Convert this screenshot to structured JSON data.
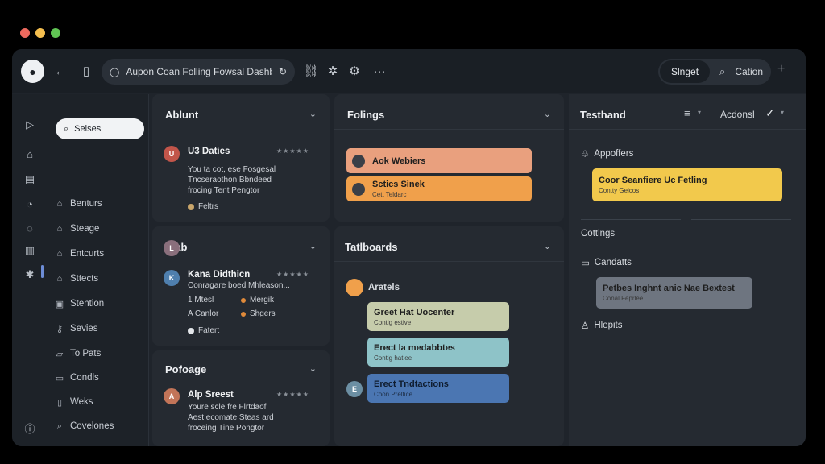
{
  "colors": {
    "traffic_red": "#ed6a5e",
    "traffic_yellow": "#f5bf4f",
    "traffic_green": "#61c554",
    "accent_salmon": "#e9a07e",
    "accent_orange": "#f0a04b",
    "accent_yellow": "#f2c94c",
    "accent_sage": "#c6ccab",
    "accent_teal": "#8ec3c8",
    "accent_blue": "#4b76b2",
    "accent_gray": "#6e7580"
  },
  "topbar": {
    "search_text": "Aupon Coan Folling Fowsal Dashbart",
    "pill_selected": "Slnget",
    "pill_action": "Cation",
    "icons": [
      "mic-icon",
      "back-arrow-icon",
      "book-icon",
      "search-icon",
      "refresh-icon",
      "network-icon",
      "settings-icon",
      "gear-icon",
      "more-icon",
      "plus-icon"
    ]
  },
  "sidebar": {
    "search_label": "Selses",
    "items": [
      {
        "label": "Benturs",
        "icon": "lock-icon"
      },
      {
        "label": "Steage",
        "icon": "lock-icon"
      },
      {
        "label": "Entcurts",
        "icon": "lock-icon"
      },
      {
        "label": "Sttects",
        "icon": "lock-icon"
      },
      {
        "label": "Stention",
        "icon": "panel-icon"
      },
      {
        "label": "Sevies",
        "icon": "key-icon"
      },
      {
        "label": "To Pats",
        "icon": "folder-icon"
      },
      {
        "label": "Condls",
        "icon": "card-icon"
      },
      {
        "label": "Weks",
        "icon": "clipboard-icon"
      },
      {
        "label": "Covelones",
        "icon": "search-icon"
      }
    ]
  },
  "col1": {
    "card1": {
      "title": "Ablunt",
      "name": "U3 Daties",
      "stars": "★★★★★",
      "text": "You ta cot, ese Fosgesal\nTncseraothon Bbndeed\nfrocing Tent Pengtor",
      "meta": "Feltrs"
    },
    "card2": {
      "title": "Lfab",
      "name": "Kana Didthicn",
      "stars": "★★★★★",
      "text": "Conragare boed Mhleason...",
      "meta": [
        "1 Mtesl",
        "Mergik",
        "A Canlor",
        "Shgers"
      ],
      "footer": "Fatert"
    },
    "card3": {
      "title": "Pofoage",
      "name": "Alp Sreest",
      "stars": "★★★★★",
      "text": "Youre scle fre Flrtdaof\nAest ecomate Steas ard\nfroceing Tine Pongtor"
    }
  },
  "col2": {
    "card1": {
      "title": "Folings",
      "tags": [
        {
          "title": "Aok Webiers",
          "sub": ""
        },
        {
          "title": "Sctics Sinek",
          "sub": "Cett Teldarc"
        }
      ]
    },
    "card2": {
      "title": "Tatlboards",
      "label": "Aratels",
      "tags": [
        {
          "title": "Greet Hat Uocenter",
          "sub": "Contlg estive"
        },
        {
          "title": "Erect la medabbtes",
          "sub": "Contig hatlee"
        },
        {
          "title": "Erect Tndtactions",
          "sub": "Coon Preltice"
        }
      ]
    }
  },
  "col3": {
    "title": "Testhand",
    "action": "Acdonsl",
    "section1": "Appoffers",
    "tag1": {
      "title": "Coor Seanfiere Uc Fetling",
      "sub": "Contty Gelcos"
    },
    "section2": "Cottlngs",
    "section3": "Candatts",
    "tag2": {
      "title": "Petbes Inghnt anic Nae Bextest",
      "sub": "Conal Feprlee"
    },
    "section4": "Hlepits"
  }
}
